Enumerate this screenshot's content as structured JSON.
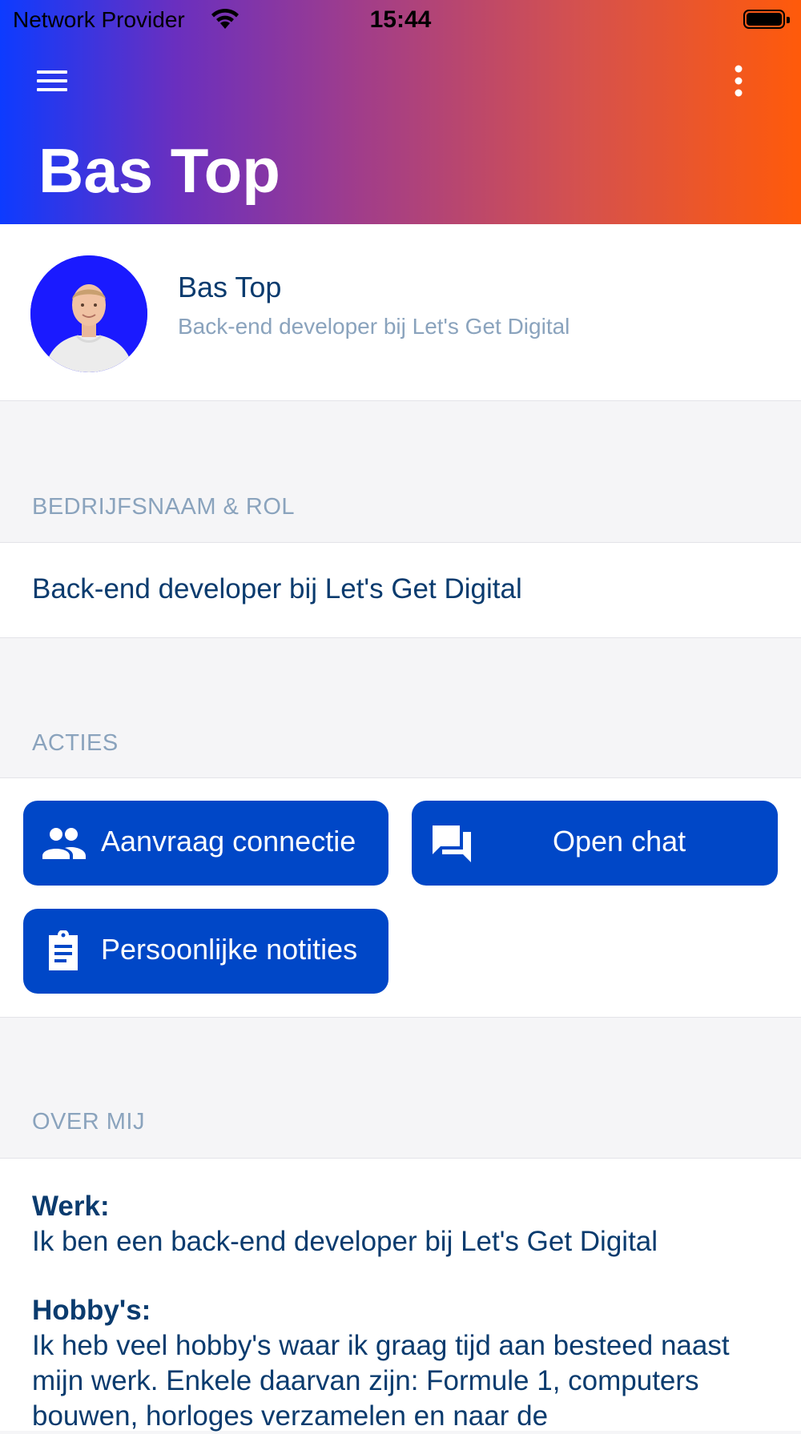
{
  "status_bar": {
    "carrier": "Network Provider",
    "time": "15:44"
  },
  "header": {
    "title": "Bas Top",
    "menu_icon": "hamburger-menu-icon",
    "more_icon": "vertical-dots-icon",
    "gradient_colors": [
      "#0d3bff",
      "#6a2fbf",
      "#a13d8a",
      "#d4514f",
      "#ff5a0a"
    ]
  },
  "profile": {
    "name": "Bas Top",
    "role": "Back-end developer bij Let's Get Digital",
    "avatar_bg": "#1a1aff"
  },
  "company_section": {
    "label": "BEDRIJFSNAAM & ROL",
    "value": "Back-end developer bij Let's Get Digital"
  },
  "actions_section": {
    "label": "ACTIES",
    "buttons": [
      {
        "label": "Aanvraag connectie",
        "icon": "people-icon"
      },
      {
        "label": "Open chat",
        "icon": "chat-icon"
      },
      {
        "label": "Persoonlijke notities",
        "icon": "clipboard-icon"
      }
    ],
    "button_color": "#0047c7"
  },
  "about_section": {
    "label": "OVER MIJ",
    "work_heading": "Werk:",
    "work_text": "Ik ben een back-end developer bij Let's Get Digital",
    "hobby_heading": "Hobby's:",
    "hobby_text": "Ik heb veel hobby's waar ik graag tijd aan besteed naast mijn werk. Enkele daarvan zijn: Formule 1, computers bouwen, horloges verzamelen en naar de"
  }
}
